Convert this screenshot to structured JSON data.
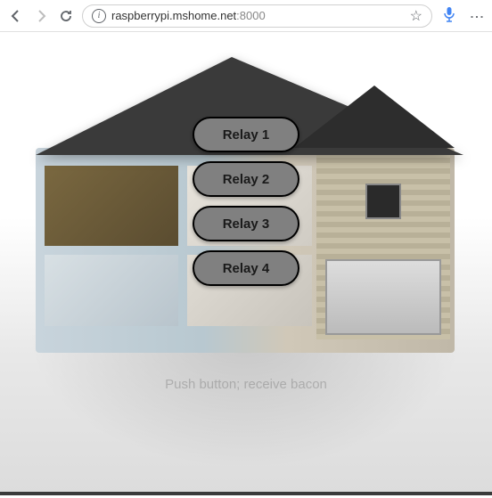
{
  "browser": {
    "url_host": "raspberrypi.mshome.net",
    "url_port": ":8000"
  },
  "buttons": [
    {
      "label": "Relay 1"
    },
    {
      "label": "Relay 2"
    },
    {
      "label": "Relay 3"
    },
    {
      "label": "Relay 4"
    }
  ],
  "caption": "Push button; receive bacon"
}
